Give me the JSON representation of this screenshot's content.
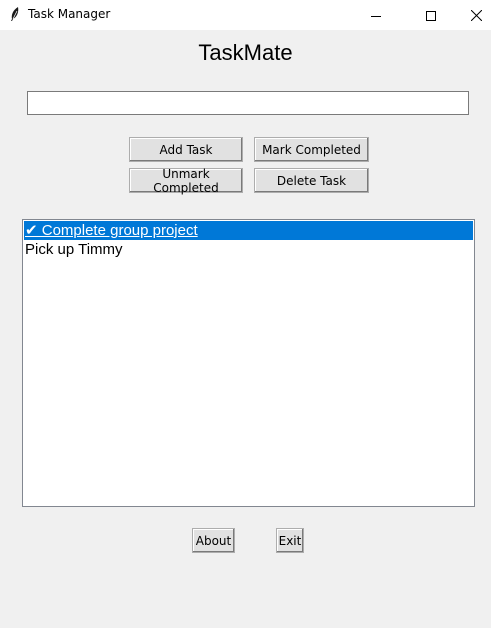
{
  "window": {
    "title": "Task Manager"
  },
  "app": {
    "heading": "TaskMate"
  },
  "entry": {
    "value": ""
  },
  "buttons": {
    "add_task": "Add Task",
    "mark_completed": "Mark Completed",
    "unmark_completed": "Unmark Completed",
    "delete_task": "Delete Task",
    "about": "About",
    "exit": "Exit"
  },
  "tasks": [
    {
      "text": "✔ Complete group project",
      "completed": true,
      "selected": true
    },
    {
      "text": "Pick up Timmy",
      "completed": false,
      "selected": false
    }
  ],
  "colors": {
    "selection": "#0078d7",
    "background": "#f0f0f0"
  },
  "icons": {
    "app": "feather-icon",
    "minimize": "minimize-icon",
    "maximize": "maximize-icon",
    "close": "close-icon"
  }
}
